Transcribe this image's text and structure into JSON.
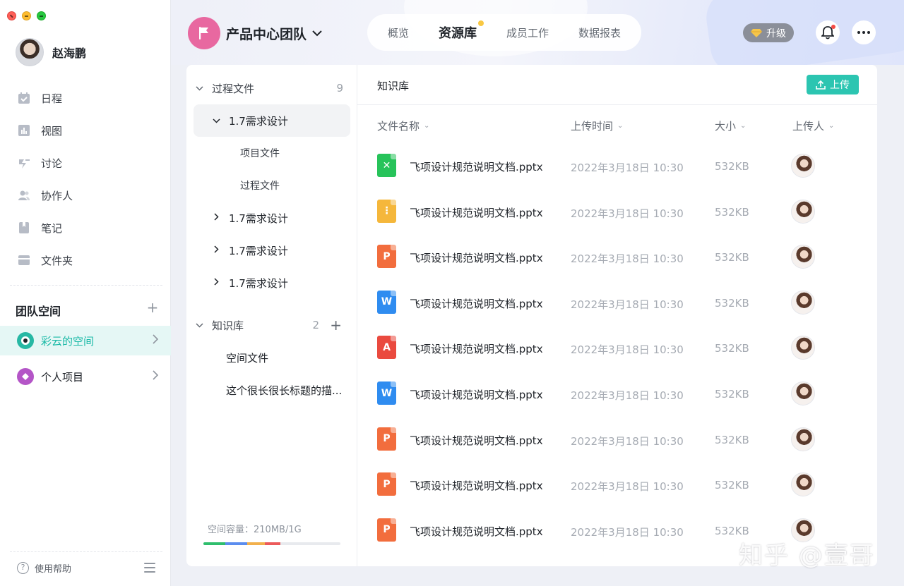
{
  "user": {
    "name": "赵海鹏"
  },
  "nav": [
    {
      "label": "日程",
      "icon": "calendar-icon"
    },
    {
      "label": "视图",
      "icon": "chart-icon"
    },
    {
      "label": "讨论",
      "icon": "discussion-icon"
    },
    {
      "label": "协作人",
      "icon": "people-icon"
    },
    {
      "label": "笔记",
      "icon": "note-icon"
    },
    {
      "label": "文件夹",
      "icon": "folder-icon"
    }
  ],
  "team_space": {
    "title": "团队空间",
    "items": [
      {
        "label": "彩云的空间",
        "active": true
      },
      {
        "label": "个人项目",
        "active": false
      }
    ]
  },
  "help": {
    "label": "使用帮助"
  },
  "header": {
    "team_name": "产品中心团队",
    "tabs": [
      "概览",
      "资源库",
      "成员工作",
      "数据报表"
    ],
    "active_tab": "资源库",
    "upgrade_label": "升级"
  },
  "tree": {
    "process_files": {
      "label": "过程文件",
      "count": "9"
    },
    "items": [
      "1.7需求设计",
      "项目文件",
      "过程文件",
      "1.7需求设计",
      "1.7需求设计",
      "1.7需求设计"
    ],
    "knowledge": {
      "label": "知识库",
      "count": "2"
    },
    "knowledge_items": [
      "空间文件",
      "这个很长很长标题的描..."
    ],
    "capacity": "空间容量：210MB/1G",
    "capacity_segments": [
      {
        "color": "#2fbe6d",
        "fraction": 0.16
      },
      {
        "color": "#5b8def",
        "fraction": 0.16
      },
      {
        "color": "#f2b04c",
        "fraction": 0.13
      },
      {
        "color": "#ec5a5a",
        "fraction": 0.11
      }
    ]
  },
  "files": {
    "title": "知识库",
    "upload_label": "上传",
    "columns": [
      "文件名称",
      "上传时间",
      "大小",
      "上传人"
    ],
    "rows": [
      {
        "name": "飞项设计规范说明文档.pptx",
        "time": "2022年3月18日 10:30",
        "size": "532KB",
        "type": "excel",
        "color": "#27c35a",
        "glyph": "✕"
      },
      {
        "name": "飞项设计规范说明文档.pptx",
        "time": "2022年3月18日 10:30",
        "size": "532KB",
        "type": "zip",
        "color": "#f5b73b",
        "glyph": "⋮"
      },
      {
        "name": "飞项设计规范说明文档.pptx",
        "time": "2022年3月18日 10:30",
        "size": "532KB",
        "type": "ppt",
        "color": "#f26d3d",
        "glyph": "P"
      },
      {
        "name": "飞项设计规范说明文档.pptx",
        "time": "2022年3月18日 10:30",
        "size": "532KB",
        "type": "word",
        "color": "#2f8cf0",
        "glyph": "W"
      },
      {
        "name": "飞项设计规范说明文档.pptx",
        "time": "2022年3月18日 10:30",
        "size": "532KB",
        "type": "pdf",
        "color": "#ea4a3f",
        "glyph": "A"
      },
      {
        "name": "飞项设计规范说明文档.pptx",
        "time": "2022年3月18日 10:30",
        "size": "532KB",
        "type": "word",
        "color": "#2f8cf0",
        "glyph": "W"
      },
      {
        "name": "飞项设计规范说明文档.pptx",
        "time": "2022年3月18日 10:30",
        "size": "532KB",
        "type": "ppt",
        "color": "#f26d3d",
        "glyph": "P"
      },
      {
        "name": "飞项设计规范说明文档.pptx",
        "time": "2022年3月18日 10:30",
        "size": "532KB",
        "type": "ppt",
        "color": "#f26d3d",
        "glyph": "P"
      },
      {
        "name": "飞项设计规范说明文档.pptx",
        "time": "2022年3月18日 10:30",
        "size": "532KB",
        "type": "ppt",
        "color": "#f26d3d",
        "glyph": "P"
      }
    ]
  },
  "watermark": "知乎 @壹哥"
}
